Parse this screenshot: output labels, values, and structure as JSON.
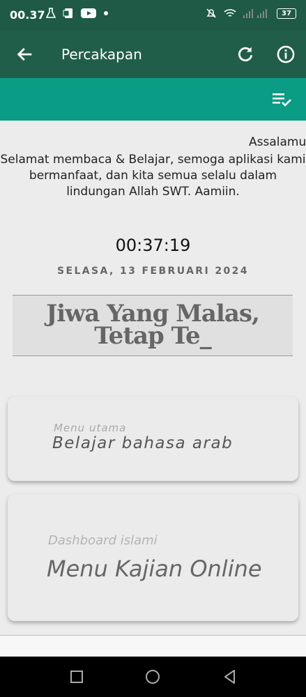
{
  "status": {
    "time": "00.37",
    "battery": "37"
  },
  "appbar": {
    "title": "Percakapan"
  },
  "marquee": "Assalamu",
  "welcome": "Selamat membaca & Belajar, semoga aplikasi kami bermanfaat, dan kita semua selalu dalam lindungan Allah SWT. Aamiin.",
  "clock": "00:37:19",
  "date": "SELASA, 13 FEBRUARI 2024",
  "quote": "Jiwa Yang Malas, Tetap Te_",
  "cards": [
    {
      "subtitle": "Menu utama",
      "title": "Belajar bahasa arab"
    },
    {
      "subtitle": "Dashboard islami",
      "title": "Menu Kajian Online"
    }
  ],
  "colors": {
    "statusbar": "#1e5a45",
    "appbar": "#215e49",
    "subbar": "#0b9c86"
  },
  "icons": [
    "back-arrow-icon",
    "refresh-icon",
    "info-icon",
    "checklist-icon",
    "square-nav-icon",
    "circle-nav-icon",
    "triangle-nav-icon"
  ]
}
